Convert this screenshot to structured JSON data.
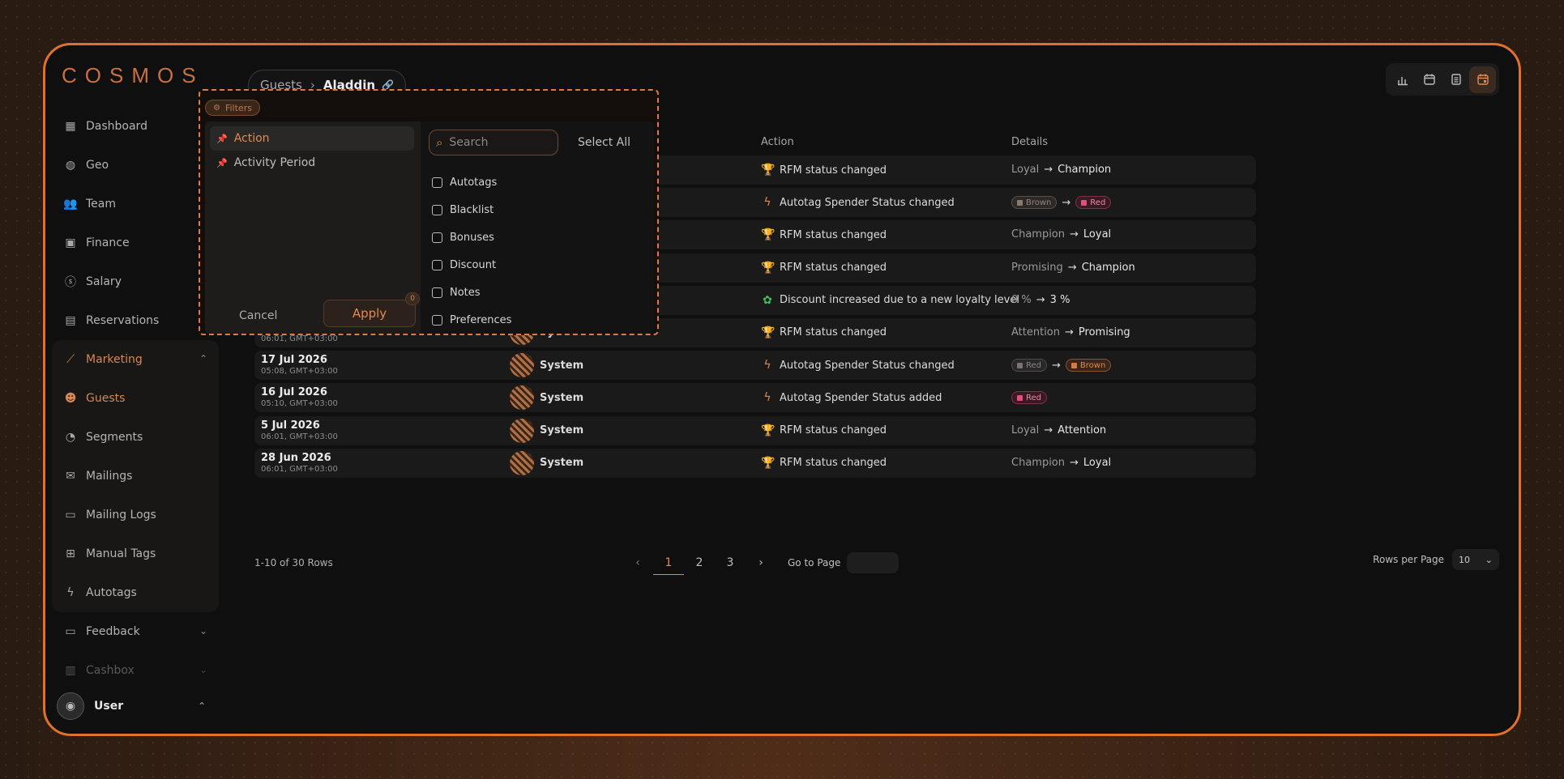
{
  "app": {
    "logo": "COSMOS"
  },
  "sidebar": {
    "items": [
      {
        "label": "Dashboard",
        "icon": "dashboard-icon",
        "chevron": false
      },
      {
        "label": "Geo",
        "icon": "globe-icon",
        "chevron": true
      },
      {
        "label": "Team",
        "icon": "team-icon",
        "chevron": true
      },
      {
        "label": "Finance",
        "icon": "finance-icon",
        "chevron": true
      },
      {
        "label": "Salary",
        "icon": "salary-icon",
        "chevron": true
      },
      {
        "label": "Reservations",
        "icon": "calendar-icon",
        "chevron": true
      }
    ],
    "marketing": {
      "label": "Marketing",
      "children": [
        "Guests",
        "Segments",
        "Mailings",
        "Mailing Logs",
        "Manual Tags",
        "Autotags"
      ]
    },
    "after": [
      {
        "label": "Feedback",
        "icon": "feedback-icon"
      },
      {
        "label": "Cashbox",
        "icon": "cashbox-icon"
      }
    ],
    "user": {
      "name": "User"
    }
  },
  "breadcrumb": {
    "parent": "Guests",
    "current": "Aladdin"
  },
  "filters": {
    "chip_label": "Filters",
    "options": [
      "Action",
      "Activity Period"
    ],
    "search_placeholder": "Search",
    "select_all": "Select All",
    "checkboxes": [
      "Autotags",
      "Blacklist",
      "Bonuses",
      "Discount",
      "Notes",
      "Preferences"
    ],
    "cancel": "Cancel",
    "apply": "Apply",
    "apply_count": "0"
  },
  "table": {
    "headers": {
      "action": "Action",
      "details": "Details"
    },
    "rows": [
      {
        "date": "",
        "time": "",
        "by": "",
        "action": "RFM status changed",
        "icon": "trophy-icon",
        "detail_type": "text",
        "from": "Loyal",
        "to": "Champion"
      },
      {
        "date": "",
        "time": "",
        "by": "",
        "action": "Autotag Spender Status changed",
        "icon": "bolt-icon",
        "detail_type": "tags",
        "from": "Brown",
        "to": "Red"
      },
      {
        "date": "",
        "time": "",
        "by": "",
        "action": "RFM status changed",
        "icon": "trophy-icon",
        "detail_type": "text",
        "from": "Champion",
        "to": "Loyal"
      },
      {
        "date": "",
        "time": "",
        "by": "",
        "action": "RFM status changed",
        "icon": "trophy-icon",
        "detail_type": "text",
        "from": "Promising",
        "to": "Champion"
      },
      {
        "date": "",
        "time": "",
        "by": "",
        "action": "Discount increased due to a new loyalty level",
        "icon": "discount-icon",
        "detail_type": "text",
        "from": "0 %",
        "to": "3 %"
      },
      {
        "date": "",
        "time": "06:01, GMT+03:00",
        "by": "System",
        "action": "RFM status changed",
        "icon": "trophy-icon",
        "detail_type": "text",
        "from": "Attention",
        "to": "Promising"
      },
      {
        "date": "17 Jul 2026",
        "time": "05:08, GMT+03:00",
        "by": "System",
        "action": "Autotag Spender Status changed",
        "icon": "bolt-icon",
        "detail_type": "tags2",
        "from": "Red",
        "to": "Brown"
      },
      {
        "date": "16 Jul 2026",
        "time": "05:10, GMT+03:00",
        "by": "System",
        "action": "Autotag Spender Status added",
        "icon": "bolt-icon",
        "detail_type": "single",
        "from": "",
        "to": "Red"
      },
      {
        "date": "5 Jul 2026",
        "time": "06:01, GMT+03:00",
        "by": "System",
        "action": "RFM status changed",
        "icon": "trophy-icon",
        "detail_type": "text",
        "from": "Loyal",
        "to": "Attention"
      },
      {
        "date": "28 Jun 2026",
        "time": "06:01, GMT+03:00",
        "by": "System",
        "action": "RFM status changed",
        "icon": "trophy-icon",
        "detail_type": "text",
        "from": "Champion",
        "to": "Loyal"
      }
    ]
  },
  "pagination": {
    "rows_count": "1-10  of  30 Rows",
    "pages": [
      "1",
      "2",
      "3"
    ],
    "current_page": "1",
    "goto_label": "Go to Page",
    "rows_per_page_label": "Rows per Page",
    "rows_per_page": "10"
  }
}
